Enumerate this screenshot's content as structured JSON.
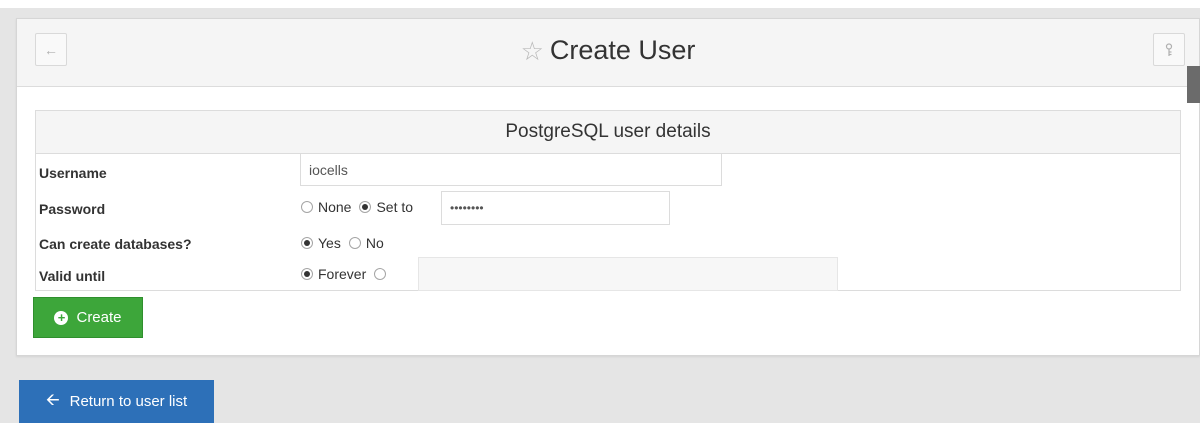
{
  "header": {
    "title": "Create User",
    "back_icon": "arrow-left-icon",
    "star_icon": "star-outline-icon",
    "key_icon": "key-icon"
  },
  "section": {
    "title": "PostgreSQL user details"
  },
  "form": {
    "username": {
      "label": "Username",
      "value": "iocells"
    },
    "password": {
      "label": "Password",
      "options": [
        "None",
        "Set to"
      ],
      "selected": "Set to",
      "masked_value": "••••••••"
    },
    "can_create_db": {
      "label": "Can create databases?",
      "options": [
        "Yes",
        "No"
      ],
      "selected": "Yes"
    },
    "valid_until": {
      "label": "Valid until",
      "options": [
        "Forever",
        ""
      ],
      "selected": "Forever",
      "value": ""
    }
  },
  "buttons": {
    "create_label": "Create",
    "return_label": "Return to user list"
  },
  "colors": {
    "create_button": "#3da63a",
    "return_button": "#2d70b8"
  }
}
